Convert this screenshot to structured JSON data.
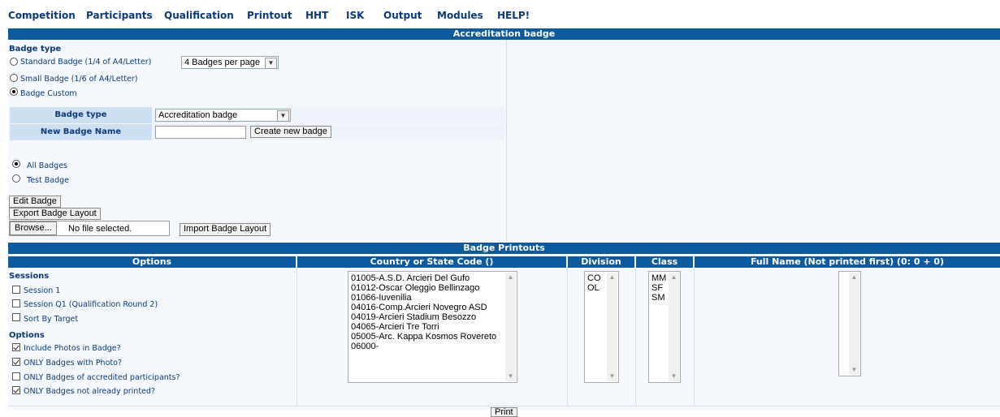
{
  "menu": [
    "Competition",
    "Participants",
    "Qualification",
    "Printout",
    "HHT",
    "ISK",
    "Output",
    "Modules",
    "HELP!"
  ],
  "accreditation": {
    "title": "Accreditation badge",
    "badge_type_label": "Badge type",
    "standard_label": "Standard Badge (1/4 of A4/Letter)",
    "badges_per_page": "4 Badges per page",
    "small_label": "Small Badge (1/6 of A4/Letter)",
    "custom_label": "Badge Custom",
    "custom_selected": true,
    "form": {
      "type_label": "Badge type",
      "type_value": "Accreditation badge",
      "new_name_label": "New Badge Name",
      "new_name_value": "",
      "create_button": "Create new badge"
    },
    "all_badges": "All Badges",
    "test_badge": "Test Badge",
    "edit_button": "Edit Badge",
    "export_button": "Export Badge Layout",
    "browse_button": "Browse...",
    "file_status": "No file selected.",
    "import_button": "Import Badge Layout"
  },
  "printouts": {
    "title": "Badge Printouts",
    "columns": {
      "options": "Options",
      "country": "Country or State Code ()",
      "division": "Division",
      "class": "Class",
      "fullname": "Full Name (Not printed first) (0: 0 + 0)"
    },
    "sessions_label": "Sessions",
    "sessions": [
      {
        "label": "Session 1",
        "checked": false
      },
      {
        "label": "Session Q1 (Qualification Round 2)",
        "checked": false
      },
      {
        "label": "Sort By Target",
        "checked": false
      }
    ],
    "options_label": "Options",
    "options": [
      {
        "label": "Include Photos in Badge?",
        "checked": true
      },
      {
        "label": "ONLY Badges with Photo?",
        "checked": true
      },
      {
        "label": "ONLY Badges of accredited participants?",
        "checked": false
      },
      {
        "label": "ONLY Badges not already printed?",
        "checked": true
      }
    ],
    "countries": [
      "01005-A.S.D. Arcieri Del Gufo",
      "01012-Oscar Oleggio Bellinzago",
      "01066-Iuvenilia",
      "04016-Comp.Arcieri Novegro ASD",
      "04019-Arcieri Stadium Besozzo",
      "04065-Arcieri Tre Torri",
      "05005-Arc. Kappa Kosmos Rovereto",
      "06000-"
    ],
    "divisions": [
      "CO",
      "OL"
    ],
    "classes": [
      "MM",
      "SF",
      "SM"
    ],
    "print_button": "Print"
  }
}
